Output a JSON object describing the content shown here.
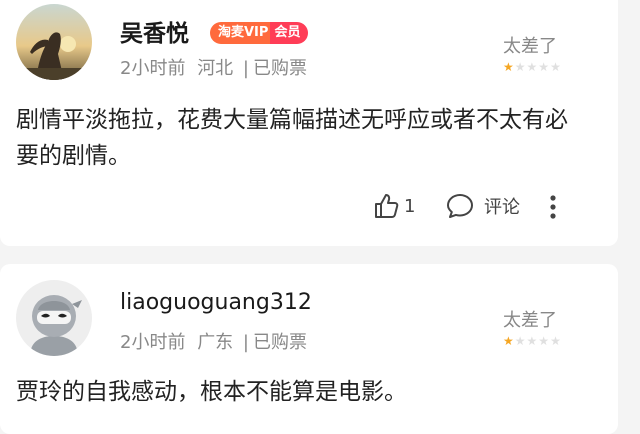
{
  "comments": [
    {
      "username": "吴香悦",
      "badge": {
        "part1": "淘麦VIP",
        "part2": "会员"
      },
      "time": "2小时前",
      "location": "河北",
      "separator": "|",
      "status": "已购票",
      "rating_label": "太差了",
      "stars": 1,
      "body": "剧情平淡拖拉，花费大量篇幅描述无呼应或者不太有必要的剧情。",
      "likes": "1",
      "comment_label": "评论",
      "avatar_icon": "silhouette-sunset-avatar",
      "colors": {
        "star_on": "#f5a623",
        "star_off": "#e0e0e0"
      }
    },
    {
      "username": "liaoguoguang312",
      "time": "2小时前",
      "location": "广东",
      "separator": "|",
      "status": "已购票",
      "rating_label": "太差了",
      "stars": 1,
      "body": "贾玲的自我感动，根本不能算是电影。",
      "avatar_icon": "ninja-avatar"
    }
  ],
  "icons": {
    "like": "thumbs-up-icon",
    "comment": "comment-bubble-icon",
    "more": "more-vertical-icon"
  }
}
